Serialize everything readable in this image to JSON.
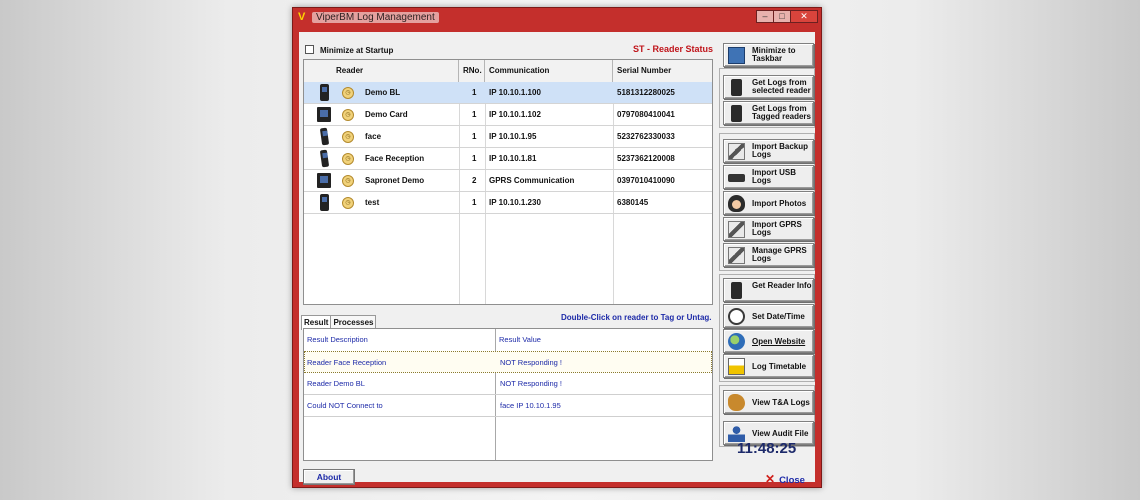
{
  "window": {
    "title": "ViperBM Log Management"
  },
  "header": {
    "minimize_startup_label": "Minimize at Startup",
    "status_title": "ST - Reader Status"
  },
  "reader_table": {
    "columns": [
      "Reader",
      "RNo.",
      "Communication",
      "Serial Number"
    ],
    "rows": [
      {
        "name": "Demo BL",
        "rno": "1",
        "comm": "IP 10.10.1.100",
        "serial": "5181312280025",
        "selected": true
      },
      {
        "name": "Demo Card",
        "rno": "1",
        "comm": "IP 10.10.1.102",
        "serial": "0797080410041"
      },
      {
        "name": "face",
        "rno": "1",
        "comm": "IP 10.10.1.95",
        "serial": "5232762330033"
      },
      {
        "name": "Face Reception",
        "rno": "1",
        "comm": "IP 10.10.1.81",
        "serial": "5237362120008"
      },
      {
        "name": "Sapronet Demo",
        "rno": "2",
        "comm": "GPRS Communication",
        "serial": "0397010410090"
      },
      {
        "name": "test",
        "rno": "1",
        "comm": "IP 10.10.1.230",
        "serial": "6380145"
      }
    ]
  },
  "tabs": [
    {
      "label": "Result"
    },
    {
      "label": "Processes"
    }
  ],
  "hint": "Double-Click on reader to Tag or Untag.",
  "result_table": {
    "columns": [
      "Result Description",
      "Result Value"
    ],
    "rows": [
      {
        "desc": "Reader Face Reception",
        "value": "NOT Responding !"
      },
      {
        "desc": "Reader Demo BL",
        "value": "NOT Responding !"
      },
      {
        "desc": "Could NOT Connect to",
        "value": "face IP 10.10.1.95"
      }
    ]
  },
  "buttons": {
    "minimize_taskbar": "Minimize to Taskbar",
    "get_logs_selected": "Get Logs from selected reader",
    "get_logs_tagged": "Get Logs from Tagged readers",
    "import_backup": "Import Backup Logs",
    "import_usb": "Import USB Logs",
    "import_photos": "Import Photos",
    "import_gprs": "Import GPRS Logs",
    "manage_gprs": "Manage GPRS Logs",
    "get_reader_info": "Get Reader Info",
    "set_datetime": "Set Date/Time",
    "open_website": "Open Website",
    "log_timetable": "Log Timetable",
    "view_ta_logs": "View T&A Logs",
    "view_audit": "View Audit File",
    "about": "About",
    "close": "Close"
  },
  "clock": "11:48:25"
}
